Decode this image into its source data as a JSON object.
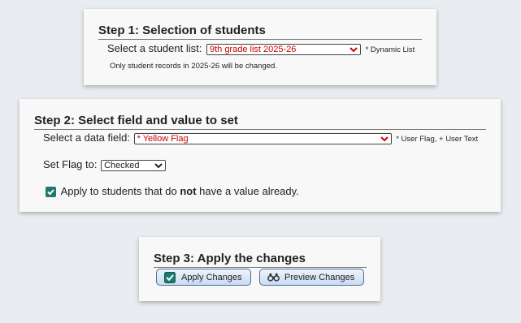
{
  "step1": {
    "title": "Step 1: Selection of students",
    "label": "Select a student list:",
    "select_value": "9th grade list 2025-26",
    "note": "* Dynamic List",
    "info": "Only student records in 2025-26 will be changed."
  },
  "step2": {
    "title": "Step 2: Select field and value to set",
    "field_label": "Select a data field:",
    "field_value": "* Yellow Flag",
    "field_note": "* User Flag, + User Text",
    "flag_label": "Set Flag to:",
    "flag_value": "Checked",
    "checkbox_checked": true,
    "checkbox_text_pre": "Apply to students that do ",
    "checkbox_text_bold": "not",
    "checkbox_text_post": " have a value already."
  },
  "step3": {
    "title": "Step 3: Apply the changes",
    "apply_label": "Apply Changes",
    "preview_label": "Preview Changes"
  },
  "icons": {
    "apply": "checkbox-check-icon",
    "preview": "binoculars-icon",
    "dropdown": "chevron-down-icon"
  },
  "colors": {
    "background": "#e9ecf0",
    "panel": "#f8f8f8",
    "select_text": "#cc0000",
    "dropdown_arrow": "#cc0000",
    "checkbox": "#1e7b6b",
    "button_border": "#4c6f9b"
  }
}
